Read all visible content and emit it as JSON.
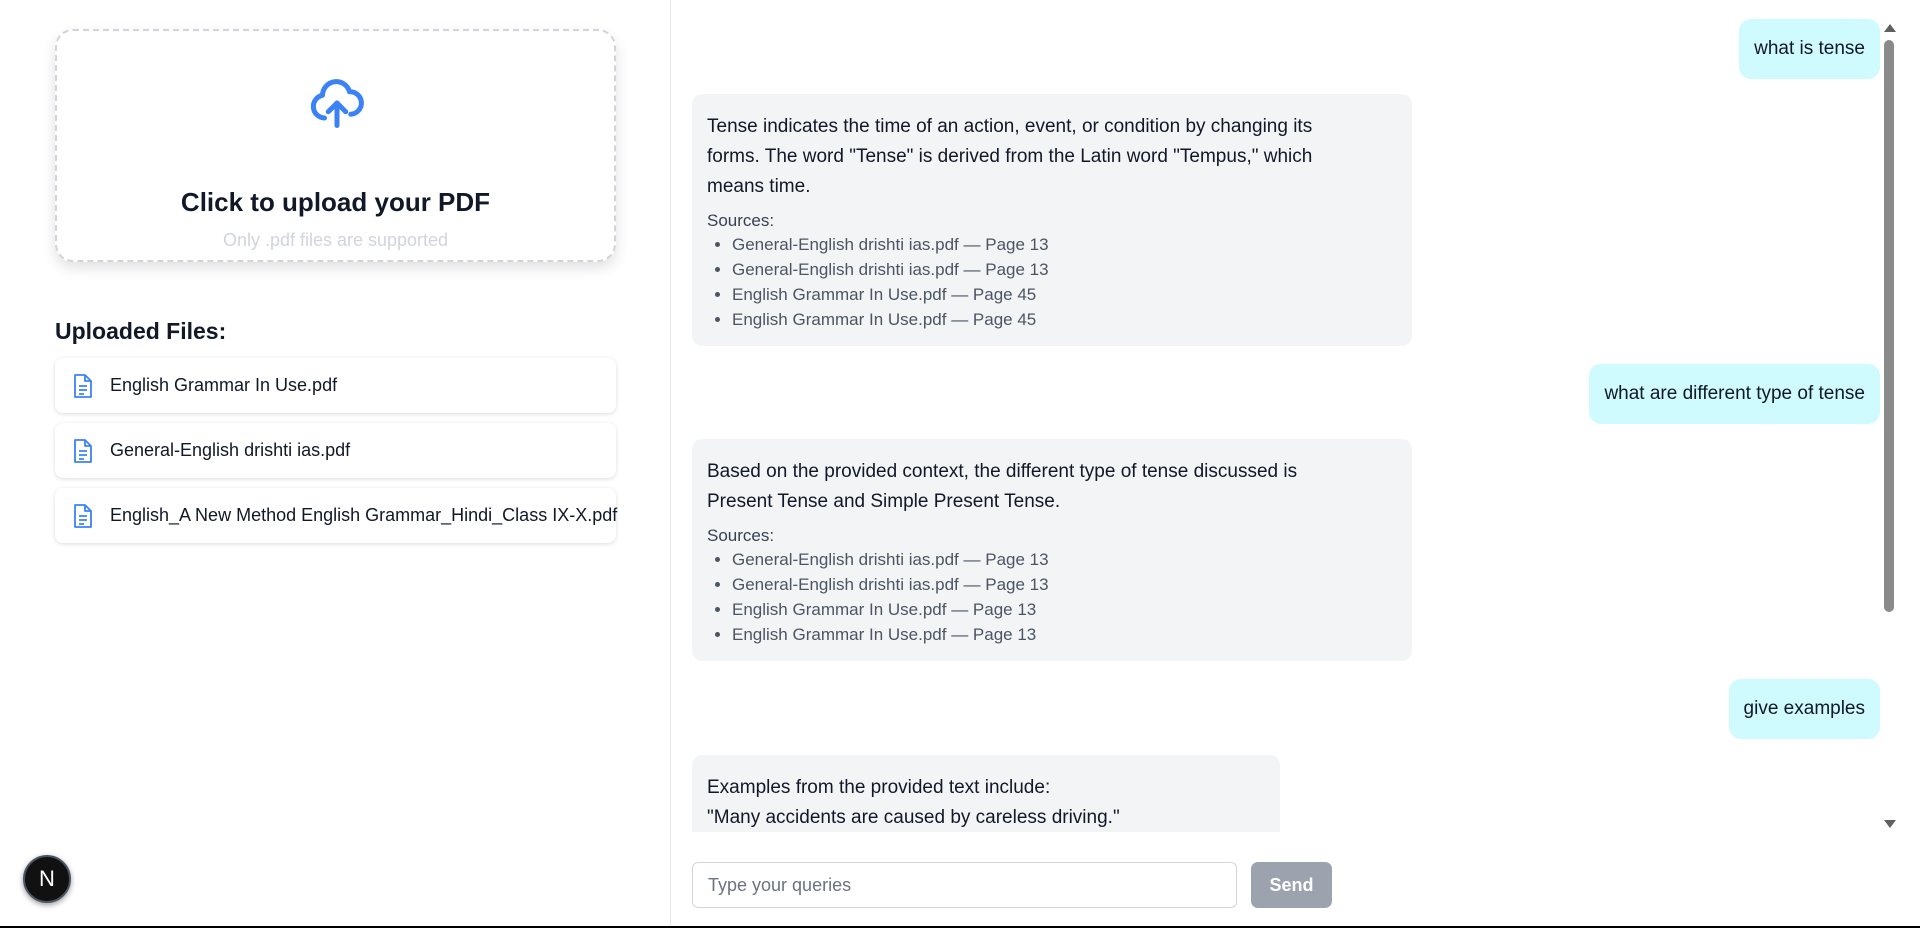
{
  "upload": {
    "title": "Click to upload your PDF",
    "subtitle": "Only .pdf files are supported",
    "icon": "cloud-upload-icon",
    "accent": "#3b82f6"
  },
  "files": {
    "heading": "Uploaded Files:",
    "items": [
      {
        "name": "English Grammar In Use.pdf"
      },
      {
        "name": "General-English drishti ias.pdf"
      },
      {
        "name": "English_A New Method English Grammar_Hindi_Class IX-X.pdf"
      }
    ]
  },
  "badge": {
    "label": "N"
  },
  "chat": {
    "messages": [
      {
        "role": "user",
        "text": "what is tense"
      },
      {
        "role": "assistant",
        "lines": [
          "Tense indicates the time of an action, event, or condition by changing its",
          "forms. The word \"Tense\" is derived from the Latin word \"Tempus,\" which",
          "means time."
        ],
        "sources_label": "Sources:",
        "sources": [
          "General-English drishti ias.pdf — Page 13",
          "General-English drishti ias.pdf — Page 13",
          "English Grammar In Use.pdf — Page 45",
          "English Grammar In Use.pdf — Page 45"
        ]
      },
      {
        "role": "user",
        "text": "what are different type of tense"
      },
      {
        "role": "assistant",
        "lines": [
          "Based on the provided context, the different type of tense discussed is",
          "Present Tense and Simple Present Tense."
        ],
        "sources_label": "Sources:",
        "sources": [
          "General-English drishti ias.pdf — Page 13",
          "General-English drishti ias.pdf — Page 13",
          "English Grammar In Use.pdf — Page 13",
          "English Grammar In Use.pdf — Page 13"
        ]
      },
      {
        "role": "user",
        "text": "give examples"
      },
      {
        "role": "assistant",
        "lines": [
          "Examples from the provided text include:",
          "\"Many accidents are caused by careless driving.\""
        ]
      }
    ]
  },
  "input": {
    "placeholder": "Type your queries",
    "value": "",
    "send_label": "Send"
  },
  "colors": {
    "user_bubble": "#cffafe",
    "assistant_bubble": "#f3f4f6",
    "send_button": "#9ca3af"
  }
}
